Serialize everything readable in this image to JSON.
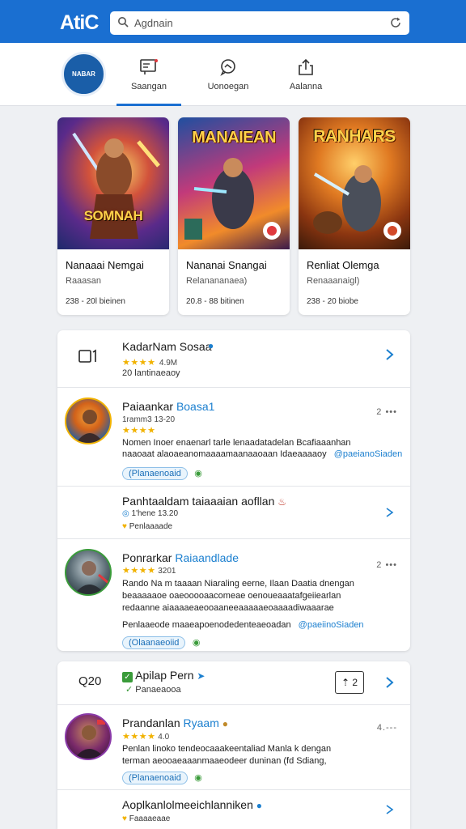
{
  "header": {
    "brand": "AtiC",
    "search_placeholder": "Agdnain"
  },
  "nav": {
    "avatar_text": "NABAR",
    "tabs": [
      {
        "label": "Saangan",
        "icon": "store-icon"
      },
      {
        "label": "Uonoegan",
        "icon": "chat-icon"
      },
      {
        "label": "Aalanna",
        "icon": "share-icon"
      }
    ]
  },
  "games": [
    {
      "art_title": "SOMNAH",
      "title": "Nanaaai Nemgai",
      "subtitle": "Raaasan",
      "meta": "238 - 20l bieinen"
    },
    {
      "art_title": "MANAIEAN",
      "title": "Nananai Snangai",
      "subtitle": "Relanananaea)",
      "meta": "20.8 - 88 bitinen"
    },
    {
      "art_title": "RANHARS",
      "title": "Renliat Olemga",
      "subtitle": "Renaaanaigl)",
      "meta": "238 - 20 biobe"
    }
  ],
  "panel1": {
    "header": {
      "title": "KadarNam Sosaa",
      "stars": "★★★★",
      "rating": "4.9M",
      "meta": "20 lantinaeaoy"
    },
    "items": [
      {
        "name": "Paiaankar",
        "name_link": "Boasa1",
        "stars": "★★★★",
        "meta": "1ramm3 13-20",
        "desc1": "Nomen Inoer enaenarl tarle lenaadatadelan Bcafiaaanhan",
        "desc2": "naaoaat alaoaeanomaaaamaanaaoaan Idaeaaaaoy",
        "desc_link": "@paeianoSiaden",
        "tag": "(Planaenoaid"
      },
      {
        "name": "Panhtaaldam taiaaaian aofllan",
        "meta": "1'hene 13.20",
        "sub": "Penlaaaade"
      },
      {
        "name": "Ponrarkar",
        "name_link": "Raiaandlade",
        "stars": "★★★★",
        "meta": "3201",
        "desc1": "Rando Na m taaaan Niaraling eerne, Ilaan Daatia dnengan",
        "desc2": "beaaaaaoe oaeooooaacomeae oenoueaaatafgeiiearlan",
        "desc3": "redaanne aiaaaaeaeooaaneeaaaaaeoaaaadiwaaarae",
        "desc4": "Penlaaeode maaeapoenodedenteaeoadan",
        "desc_link": "@paeiinoSiaden",
        "tag": "(Olaanaeoiid"
      }
    ]
  },
  "panel2": {
    "header": {
      "count": "Q20",
      "title": "Apilap Pern",
      "sub": "Panaeaooa",
      "badge": "2"
    },
    "items": [
      {
        "name": "Prandanlan",
        "name_link": "Ryaam",
        "stars": "★★★★",
        "rating": "4.0",
        "meta": "4.---",
        "desc1": "Penlan linoko tendeocaaakeentaliad Manla k dengan",
        "desc2": "terman aeooaeaaanmaaeodeer duninan (fd Sdiang,",
        "tag": "(Planaenoaid"
      },
      {
        "name": "Aoplkanlolmeeichlanniken",
        "sub": "Faaaaeaae"
      }
    ]
  },
  "colors": {
    "header_blue": "#1a6fd1",
    "link_blue": "#1b7fcf",
    "star_gold": "#f1b200",
    "background": "#eef0f3"
  }
}
